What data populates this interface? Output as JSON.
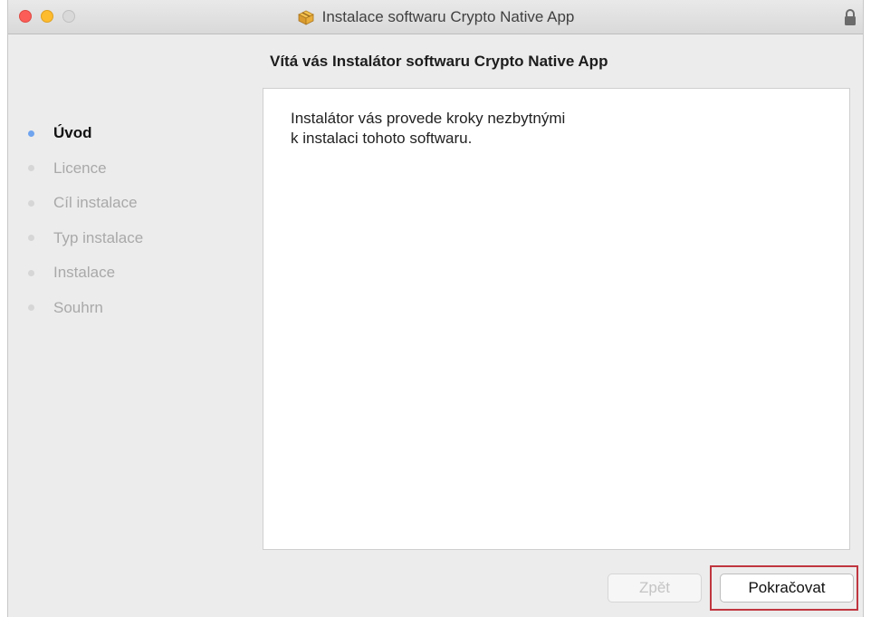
{
  "window": {
    "title": "Instalace softwaru Crypto Native App"
  },
  "page": {
    "heading": "Vítá vás Instalátor softwaru Crypto Native App",
    "content_text": "Instalátor vás provede kroky nezbytnými\nk instalaci tohoto softwaru."
  },
  "steps": [
    {
      "label": "Úvod",
      "active": true
    },
    {
      "label": "Licence",
      "active": false
    },
    {
      "label": "Cíl instalace",
      "active": false
    },
    {
      "label": "Typ instalace",
      "active": false
    },
    {
      "label": "Instalace",
      "active": false
    },
    {
      "label": "Souhrn",
      "active": false
    }
  ],
  "buttons": {
    "back_label": "Zpět",
    "back_enabled": false,
    "continue_label": "Pokračovat"
  },
  "icons": {
    "title_icon": "package-icon",
    "lock_icon": "lock-icon"
  },
  "colors": {
    "active_step_dot": "#6fa4ef",
    "highlight_border": "#c0363f"
  }
}
